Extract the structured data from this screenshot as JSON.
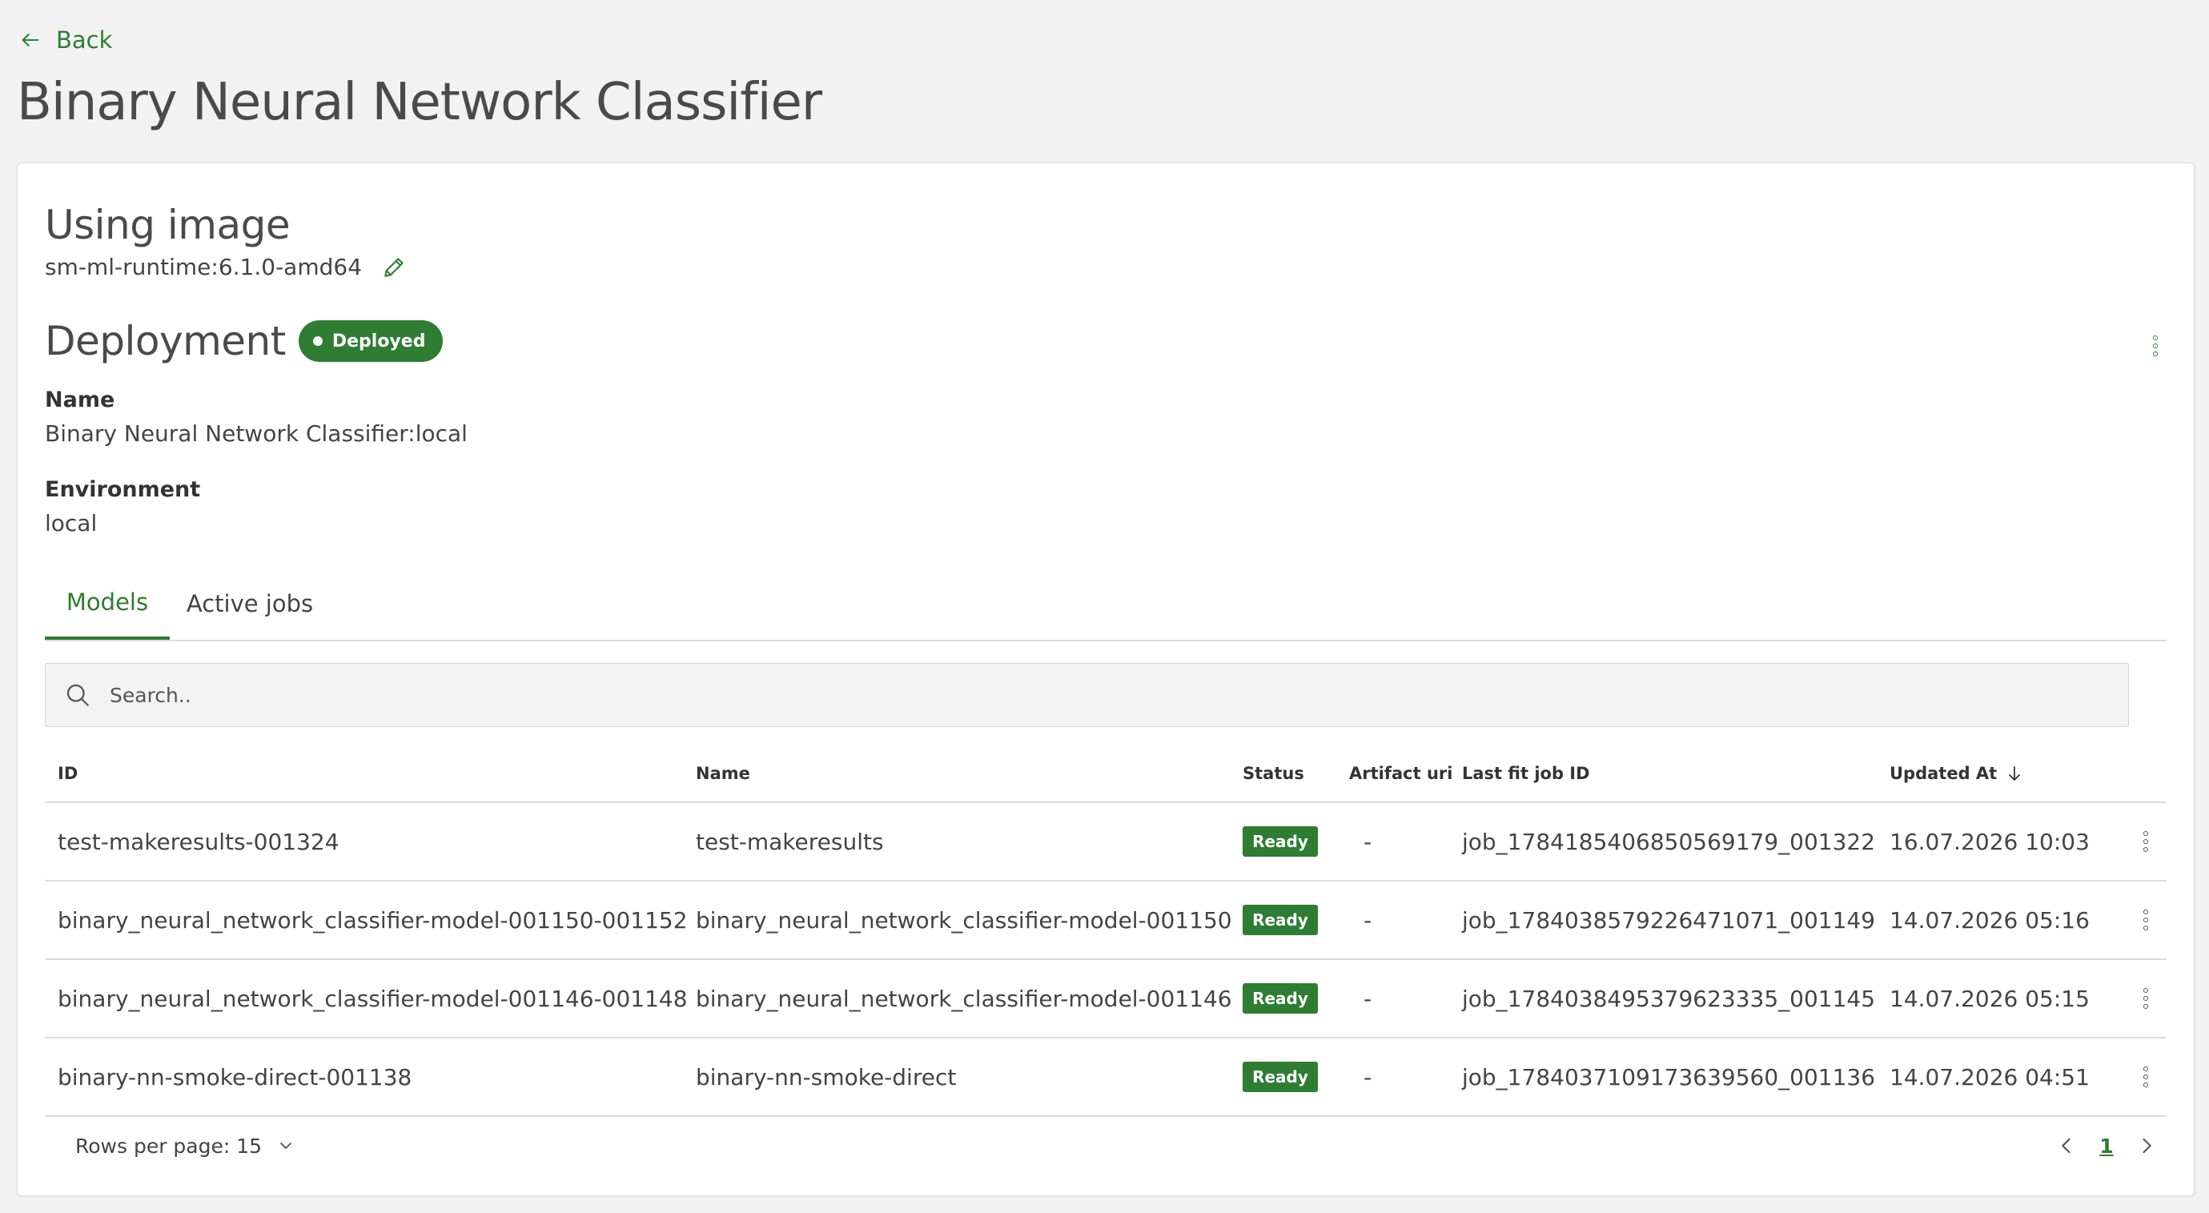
{
  "nav": {
    "back_label": "Back"
  },
  "page": {
    "title": "Binary Neural Network Classifier"
  },
  "image": {
    "heading": "Using image",
    "name": "sm-ml-runtime:6.1.0-amd64"
  },
  "deployment": {
    "heading": "Deployment",
    "status_badge": "Deployed",
    "name_label": "Name",
    "name_value": "Binary Neural Network Classifier:local",
    "environment_label": "Environment",
    "environment_value": "local"
  },
  "tabs": [
    {
      "label": "Models",
      "active": true
    },
    {
      "label": "Active jobs",
      "active": false
    }
  ],
  "search": {
    "placeholder": "Search..",
    "value": ""
  },
  "table": {
    "columns": [
      "ID",
      "Name",
      "Status",
      "Artifact uri",
      "Last fit job ID",
      "Updated At"
    ],
    "sort": {
      "column": "Updated At",
      "direction": "desc"
    },
    "rows": [
      {
        "id": "test-makeresults-001324",
        "name": "test-makeresults",
        "status": "Ready",
        "artifact_uri": "-",
        "last_fit_job_id": "job_1784185406850569179_001322",
        "updated_at": "16.07.2026 10:03"
      },
      {
        "id": "binary_neural_network_classifier-model-001150-001152",
        "name": "binary_neural_network_classifier-model-001150",
        "status": "Ready",
        "artifact_uri": "-",
        "last_fit_job_id": "job_1784038579226471071_001149",
        "updated_at": "14.07.2026 05:16"
      },
      {
        "id": "binary_neural_network_classifier-model-001146-001148",
        "name": "binary_neural_network_classifier-model-001146",
        "status": "Ready",
        "artifact_uri": "-",
        "last_fit_job_id": "job_1784038495379623335_001145",
        "updated_at": "14.07.2026 05:15"
      },
      {
        "id": "binary-nn-smoke-direct-001138",
        "name": "binary-nn-smoke-direct",
        "status": "Ready",
        "artifact_uri": "-",
        "last_fit_job_id": "job_1784037109173639560_001136",
        "updated_at": "14.07.2026 04:51"
      }
    ]
  },
  "pagination": {
    "rows_per_page_label": "Rows per page: 15",
    "current_page": "1"
  },
  "colors": {
    "accent": "#2e7d32",
    "background": "#f2f2f2",
    "card": "#ffffff"
  },
  "icons": {
    "back": "arrow-left-icon",
    "edit": "pencil-icon",
    "menu": "kebab-menu-icon",
    "search": "search-icon",
    "sort": "arrow-down-icon",
    "dropdown": "chevron-down-icon",
    "prev": "chevron-left-icon",
    "next": "chevron-right-icon"
  }
}
